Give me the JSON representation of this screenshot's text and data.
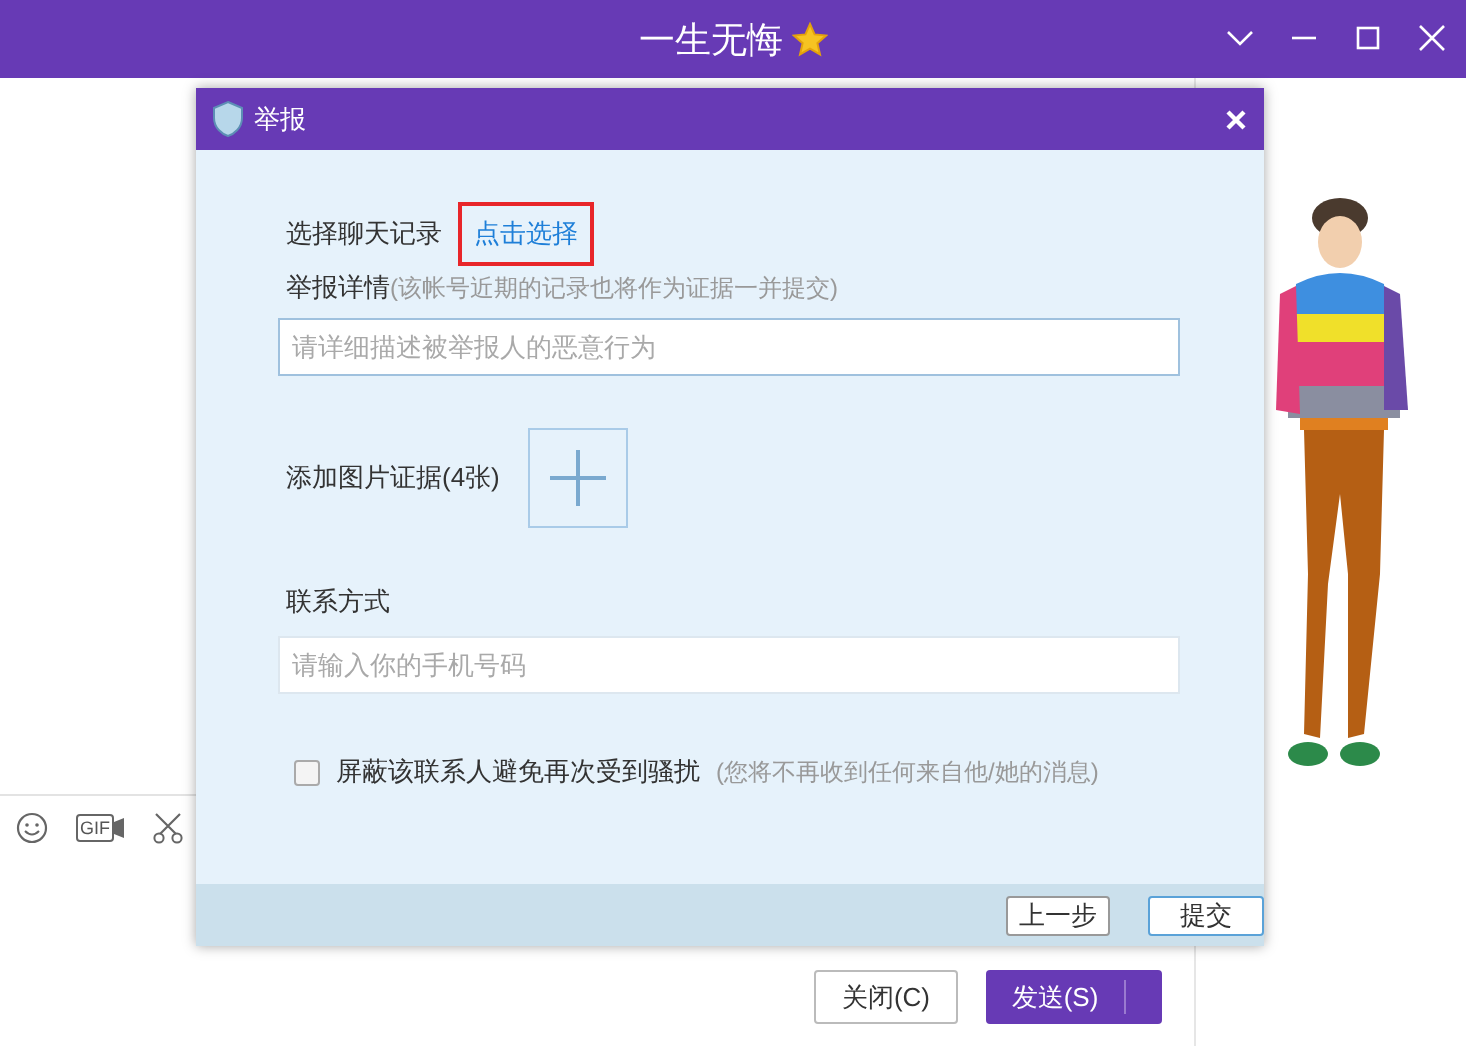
{
  "window": {
    "title": "一生无悔"
  },
  "toolbar": [
    {
      "kind": "emoji"
    },
    {
      "kind": "gif",
      "label": "GIF"
    },
    {
      "kind": "scissors"
    }
  ],
  "actions": [
    {
      "label": "关闭(C)",
      "kind": "secondary"
    },
    {
      "label": "发送(S)",
      "kind": "primary"
    }
  ],
  "dialog": {
    "title": "举报",
    "record": {
      "label": "选择聊天记录",
      "link": "点击选择",
      "highlighted": true
    },
    "details": {
      "label": "举报详情",
      "hint": "(该帐号近期的记录也将作为证据一并提交)",
      "placeholder": "请详细描述被举报人的恶意行为"
    },
    "photos": {
      "label": "添加图片证据(4张)"
    },
    "contact": {
      "label": "联系方式",
      "placeholder": "请输入你的手机号码"
    },
    "block": {
      "label": "屏蔽该联系人避免再次受到骚扰",
      "hint": "(您将不再收到任何来自他/她的消息)",
      "checked": false
    },
    "buttons": [
      "上一步",
      "提交"
    ]
  }
}
